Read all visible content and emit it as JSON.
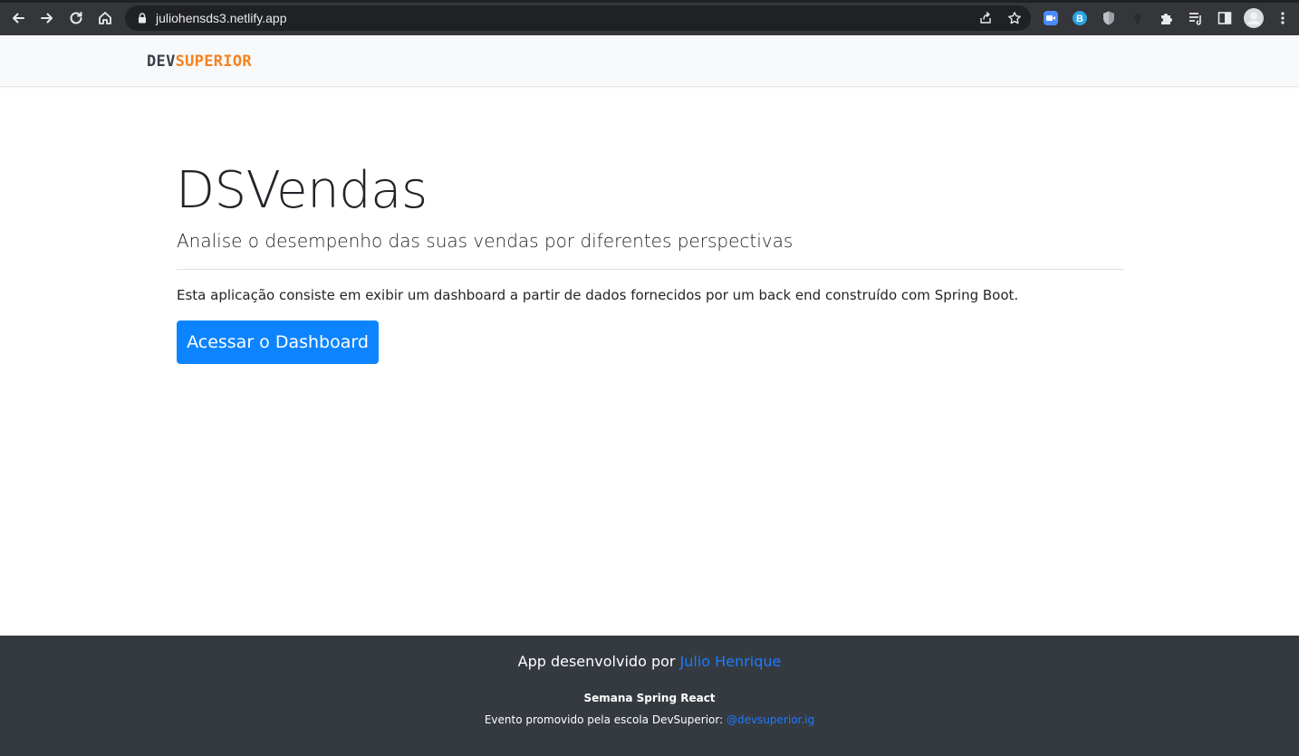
{
  "browser": {
    "url": "juliohensds3.netlify.app",
    "icons": [
      "back-arrow-icon",
      "forward-arrow-icon",
      "reload-icon",
      "home-icon",
      "lock-icon",
      "share-icon",
      "star-icon",
      "zoom-extension-icon",
      "b-extension-icon",
      "shield-extension-icon",
      "puzzle-extensions-icon",
      "reading-list-icon",
      "side-panel-icon",
      "profile-avatar-icon",
      "more-menu-icon"
    ]
  },
  "header": {
    "logo_dev": "DEV",
    "logo_superior": "SUPERIOR"
  },
  "main": {
    "title": "DSVendas",
    "subtitle": "Analise o desempenho das suas vendas por diferentes perspectivas",
    "description": "Esta aplicação consiste em exibir um dashboard a partir de dados fornecidos por um back end construído com Spring Boot.",
    "cta_label": "Acessar o Dashboard"
  },
  "footer": {
    "credit_prefix": "App desenvolvido por ",
    "credit_author": "Julio Henrique",
    "event_name": "Semana Spring React",
    "promo_prefix": "Evento promovido pela escola DevSuperior: ",
    "promo_handle": "@devsuperior.ig"
  },
  "colors": {
    "brand_orange": "#f5821f",
    "brand_dark": "#3a3f4a",
    "primary_button": "#0d84ff",
    "footer_bg": "#343a40",
    "link": "#1e7bff"
  }
}
